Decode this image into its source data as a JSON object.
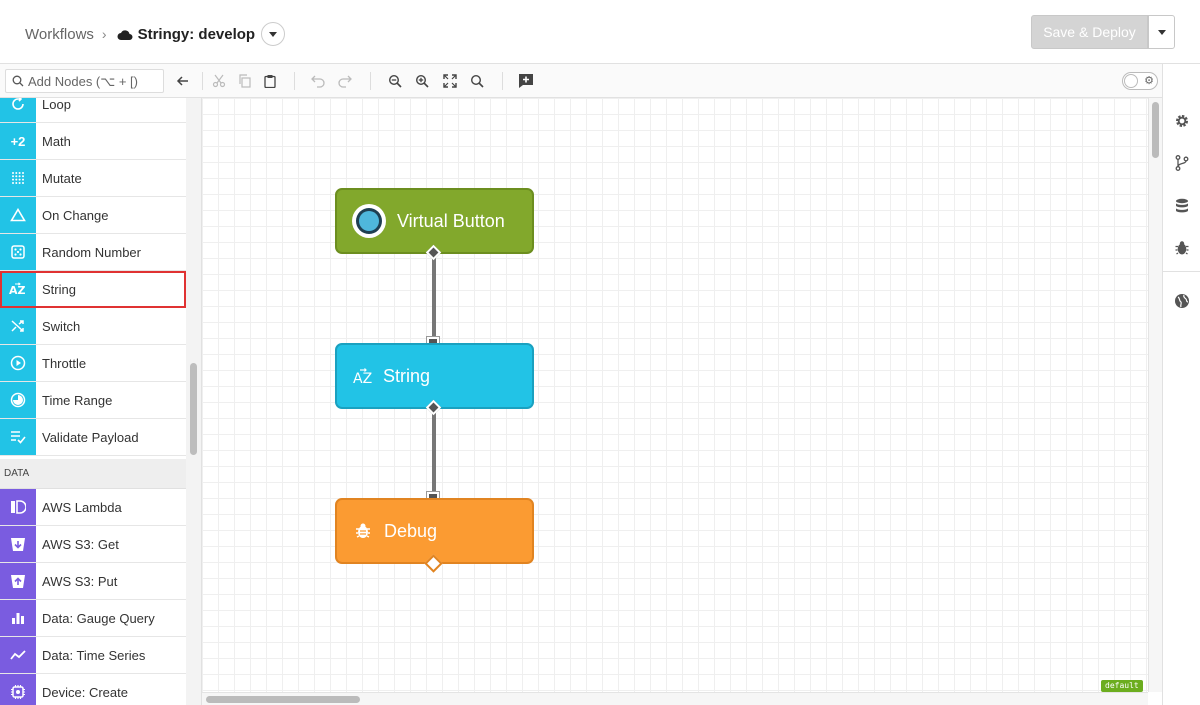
{
  "header": {
    "breadcrumb_root": "Workflows",
    "breadcrumb_sep": "›",
    "workflow_title": "Stringy: develop",
    "save_label": "Save & Deploy"
  },
  "toolbar": {
    "search_placeholder": "Add Nodes (⌥ + [)"
  },
  "sidebar": {
    "logic_items": [
      "Loop",
      "Math",
      "Mutate",
      "On Change",
      "Random Number",
      "String",
      "Switch",
      "Throttle",
      "Time Range",
      "Validate Payload"
    ],
    "math_icon_text": "+2",
    "section_data": "DATA",
    "data_items": [
      "AWS Lambda",
      "AWS S3: Get",
      "AWS S3: Put",
      "Data: Gauge Query",
      "Data: Time Series",
      "Device: Create"
    ],
    "selected_item": "String"
  },
  "canvas": {
    "nodes": [
      {
        "label": "Virtual Button",
        "color": "#82a82c"
      },
      {
        "label": "String",
        "color": "#22c3e6"
      },
      {
        "label": "Debug",
        "color": "#fb9b32"
      }
    ],
    "environment_badge": "default"
  },
  "colors": {
    "logic_accent": "#22c3e6",
    "data_accent": "#7a5ce0",
    "selection": "#e03232"
  }
}
